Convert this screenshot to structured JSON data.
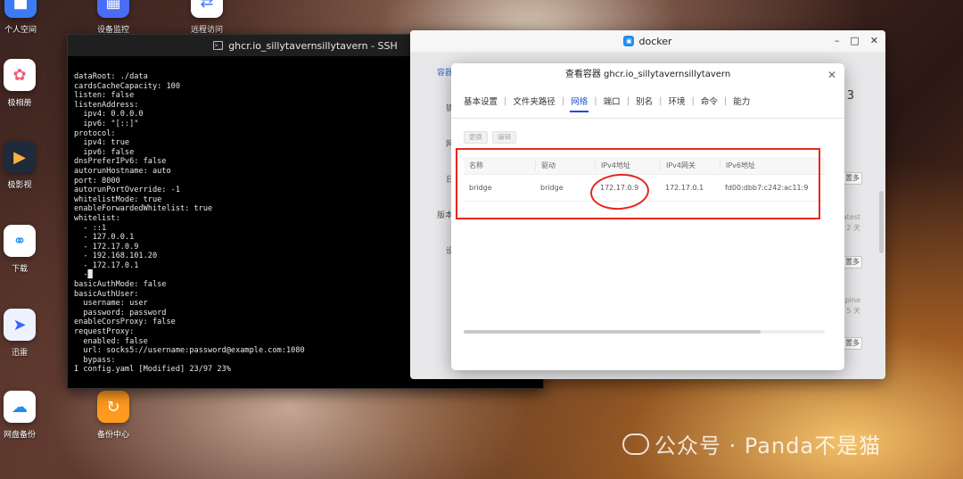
{
  "desktop": {
    "icons": [
      {
        "label": "个人空间",
        "icon": "folder-icon",
        "color": "#3b7bf6"
      },
      {
        "label": "设备监控",
        "icon": "grid-icon",
        "color": "#4a6cf7"
      },
      {
        "label": "远程访问",
        "icon": "remote-icon",
        "color": "#ffffff"
      },
      {
        "label": "极相册",
        "icon": "flower-icon",
        "color": "#ffffff"
      },
      {
        "label": "极影视",
        "icon": "film-icon",
        "color": "#1f2a3a"
      },
      {
        "label": "下载",
        "icon": "globe-download-icon",
        "color": "#ffffff"
      },
      {
        "label": "迅雷",
        "icon": "bird-icon",
        "color": "#eef2ff"
      },
      {
        "label": "网盘备份",
        "icon": "cloud-upload-icon",
        "color": "#ffffff"
      },
      {
        "label": "备份中心",
        "icon": "sync-icon",
        "color": "#ff9a1f"
      }
    ]
  },
  "ssh": {
    "title": "ghcr.io_sillytavernsillytavern - SSH",
    "lines": [
      "dataRoot: ./data",
      "cardsCacheCapacity: 100",
      "listen: false",
      "listenAddress:",
      "  ipv4: 0.0.0.0",
      "  ipv6: \"[::]\"",
      "protocol:",
      "  ipv4: true",
      "  ipv6: false",
      "dnsPreferIPv6: false",
      "autorunHostname: auto",
      "port: 8000",
      "autorunPortOverride: -1",
      "whitelistMode: true",
      "enableForwardedWhitelist: true",
      "whitelist:",
      "  - ::1",
      "  - 127.0.0.1",
      "  - 172.17.0.9",
      "  - 192.168.101.20",
      "  - 172.17.0.1",
      "  -█",
      "basicAuthMode: false",
      "basicAuthUser:",
      "  username: user",
      "  password: password",
      "enableCorsProxy: false",
      "requestProxy:",
      "  enabled: false",
      "  url: socks5://username:password@example.com:1080",
      "  bypass:",
      "I config.yaml [Modified] 23/97 23%"
    ]
  },
  "docker": {
    "title": "docker",
    "background_texts": [
      "容器",
      "镜",
      "网",
      "日",
      "版本",
      "设",
      "置多",
      "latest",
      "2 天",
      "置多",
      "alpine",
      "5 天",
      "置多",
      "3"
    ]
  },
  "dialog": {
    "title": "查看容器 ghcr.io_sillytavernsillytavern",
    "tabs": [
      "基本设置",
      "文件夹路径",
      "网络",
      "端口",
      "别名",
      "环境",
      "命令",
      "能力"
    ],
    "active_tab": "网络",
    "buttons": {
      "change": "更换",
      "edit": "编辑"
    },
    "table": {
      "headers": [
        "名称",
        "驱动",
        "IPv4地址",
        "IPv4网关",
        "IPv6地址"
      ],
      "rows": [
        [
          "bridge",
          "bridge",
          "172.17.0.9",
          "172.17.0.1",
          "fd00:dbb7:c242:ac11:9"
        ]
      ]
    }
  },
  "watermark": {
    "text": "公众号 · Panda不是猫"
  },
  "colors": {
    "accent": "#1e4fd6",
    "annotation": "#e8261d"
  }
}
